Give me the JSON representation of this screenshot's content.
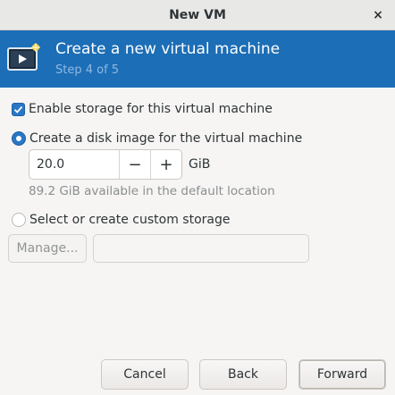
{
  "window": {
    "title": "New VM",
    "close_glyph": "×"
  },
  "banner": {
    "heading": "Create a new virtual machine",
    "step": "Step 4 of 5",
    "icon": "vm-monitor-icon",
    "background": "#1c6eb6"
  },
  "storage": {
    "enable_label": "Enable storage for this virtual machine",
    "enable_checked": true,
    "create_label": "Create a disk image for the virtual machine",
    "create_selected": true,
    "size_value": "20.0",
    "decrement_label": "−",
    "increment_label": "+",
    "unit": "GiB",
    "available_hint": "89.2 GiB available in the default location",
    "custom_label": "Select or create custom storage",
    "custom_selected": false,
    "manage_label": "Manage...",
    "custom_path_value": ""
  },
  "footer": {
    "cancel_label": "Cancel",
    "back_label": "Back",
    "forward_label": "Forward"
  },
  "colors": {
    "accent": "#2a76c6"
  }
}
